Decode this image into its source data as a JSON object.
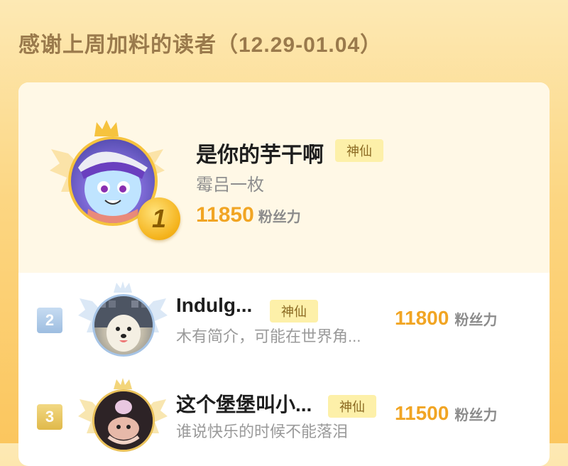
{
  "page": {
    "title": "感谢上周加料的读者（12.29-01.04）"
  },
  "leaderboard": [
    {
      "rank": "1",
      "name": "是你的芋干啊",
      "tag": "神仙",
      "bio": "霉吕一枚",
      "fans_value": "11850",
      "fans_label": "粉丝力"
    },
    {
      "rank": "2",
      "name": "Indulg...",
      "tag": "神仙",
      "bio": "木有简介，可能在世界角...",
      "fans_value": "11800",
      "fans_label": "粉丝力"
    },
    {
      "rank": "3",
      "name": "这个堡堡叫小...",
      "tag": "神仙",
      "bio": "谁说快乐的时候不能落泪",
      "fans_value": "11500",
      "fans_label": "粉丝力"
    }
  ],
  "colors": {
    "background_top": "#fde9b4",
    "background_bottom": "#fbc65e",
    "accent_gold": "#f1a524",
    "tag_bg": "#fdf0a9",
    "rank2_silver": "#9dbde0",
    "rank3_bronze": "#e0b94a"
  },
  "icons": {
    "crown": "crown-icon",
    "wings": "wings-icon"
  }
}
